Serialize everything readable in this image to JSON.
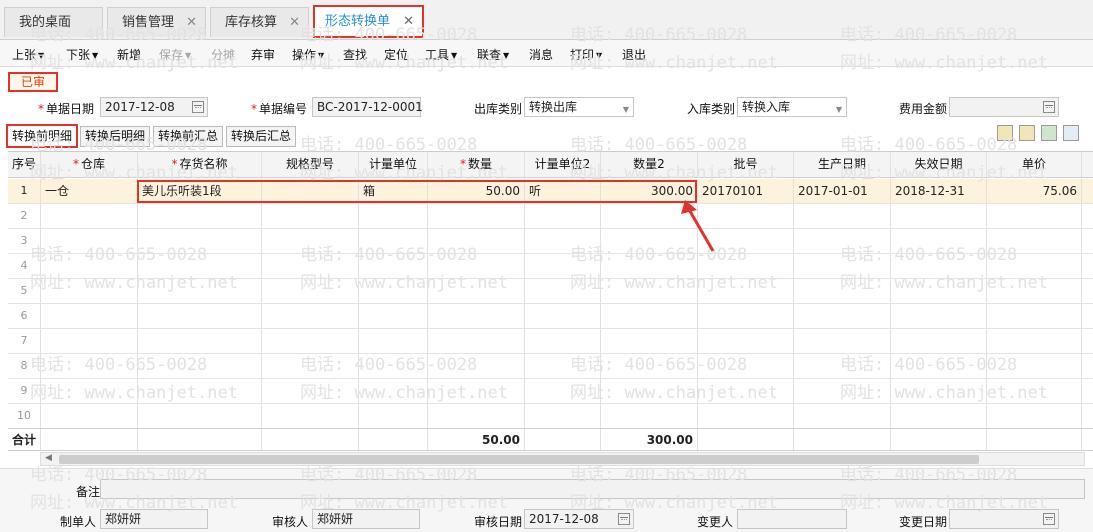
{
  "tabs": [
    {
      "label": "我的桌面",
      "closable": false
    },
    {
      "label": "销售管理",
      "closable": true
    },
    {
      "label": "库存核算",
      "closable": true
    },
    {
      "label": "形态转换单",
      "closable": true,
      "active": true
    }
  ],
  "toolbar": [
    {
      "label": "上张",
      "dropdown": true,
      "enabled": true
    },
    {
      "label": "下张",
      "dropdown": true,
      "enabled": true
    },
    {
      "label": "新增",
      "dropdown": false,
      "enabled": true
    },
    {
      "label": "保存",
      "dropdown": true,
      "enabled": false
    },
    {
      "label": "分摊",
      "dropdown": false,
      "enabled": false
    },
    {
      "label": "弃审",
      "dropdown": false,
      "enabled": true
    },
    {
      "label": "操作",
      "dropdown": true,
      "enabled": true
    },
    {
      "label": "查找",
      "dropdown": false,
      "enabled": true
    },
    {
      "label": "定位",
      "dropdown": false,
      "enabled": true
    },
    {
      "label": "工具",
      "dropdown": true,
      "enabled": true
    },
    {
      "label": "联查",
      "dropdown": true,
      "enabled": true
    },
    {
      "label": "消息",
      "dropdown": false,
      "enabled": true
    },
    {
      "label": "打印",
      "dropdown": true,
      "enabled": true
    },
    {
      "label": "退出",
      "dropdown": false,
      "enabled": true
    }
  ],
  "status_label": "已审",
  "form": {
    "doc_date_label": "单据日期",
    "doc_date": "2017-12-08",
    "doc_no_label": "单据编号",
    "doc_no": "BC-2017-12-0001",
    "out_type_label": "出库类别",
    "out_type": "转换出库",
    "in_type_label": "入库类别",
    "in_type": "转换入库",
    "fee_label": "费用金额",
    "fee": ""
  },
  "subtabs": [
    "转换前明细",
    "转换后明细",
    "转换前汇总",
    "转换后汇总"
  ],
  "table": {
    "headers": [
      "序号",
      "仓库",
      "存货名称",
      "规格型号",
      "计量单位",
      "数量",
      "计量单位2",
      "数量2",
      "批号",
      "生产日期",
      "失效日期",
      "单价"
    ],
    "required": [
      false,
      true,
      true,
      false,
      false,
      true,
      false,
      false,
      false,
      false,
      false,
      false
    ],
    "rows": [
      [
        "1",
        "一仓",
        "美儿乐听装1段",
        "",
        "箱",
        "50.00",
        "听",
        "300.00",
        "20170101",
        "2017-01-01",
        "2018-12-31",
        "75.06"
      ],
      [
        "2",
        "",
        "",
        "",
        "",
        "",
        "",
        "",
        "",
        "",
        "",
        ""
      ],
      [
        "3",
        "",
        "",
        "",
        "",
        "",
        "",
        "",
        "",
        "",
        "",
        ""
      ],
      [
        "4",
        "",
        "",
        "",
        "",
        "",
        "",
        "",
        "",
        "",
        "",
        ""
      ],
      [
        "5",
        "",
        "",
        "",
        "",
        "",
        "",
        "",
        "",
        "",
        "",
        ""
      ],
      [
        "6",
        "",
        "",
        "",
        "",
        "",
        "",
        "",
        "",
        "",
        "",
        ""
      ],
      [
        "7",
        "",
        "",
        "",
        "",
        "",
        "",
        "",
        "",
        "",
        "",
        ""
      ],
      [
        "8",
        "",
        "",
        "",
        "",
        "",
        "",
        "",
        "",
        "",
        "",
        ""
      ],
      [
        "9",
        "",
        "",
        "",
        "",
        "",
        "",
        "",
        "",
        "",
        "",
        ""
      ],
      [
        "10",
        "",
        "",
        "",
        "",
        "",
        "",
        "",
        "",
        "",
        "",
        ""
      ]
    ],
    "total_label": "合计",
    "total_qty": "50.00",
    "total_qty2": "300.00"
  },
  "footer": {
    "remark_label": "备注",
    "remark": "",
    "maker_label": "制单人",
    "maker": "郑妍妍",
    "auditor_label": "审核人",
    "auditor": "郑妍妍",
    "audit_date_label": "审核日期",
    "audit_date": "2017-12-08",
    "changer_label": "变更人",
    "changer": "",
    "change_date_label": "变更日期",
    "change_date": ""
  },
  "watermark": {
    "phone": "电话: 400-665-0028",
    "site": "网址: www.chanjet.net"
  },
  "colors": {
    "accent_blue": "#2a8fd6",
    "highlight_red": "#e0332d",
    "selected_row": "#fdf3dc"
  }
}
